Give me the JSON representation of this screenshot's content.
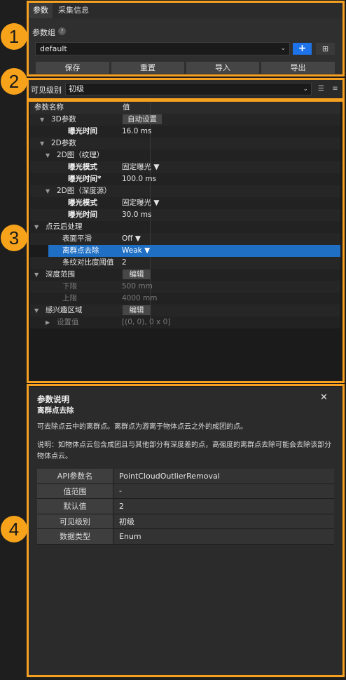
{
  "tabs": [
    "参数",
    "采集信息"
  ],
  "param_group": {
    "label": "参数组",
    "help": "?",
    "selected": "default",
    "add": "+",
    "grid": "⊞"
  },
  "actions": [
    "保存",
    "重置",
    "导入",
    "导出"
  ],
  "visibility": {
    "label": "可见级别",
    "selected": "初级"
  },
  "tree": {
    "headers": [
      "参数名称",
      "值"
    ],
    "rows": [
      {
        "name": "3D参数",
        "value": "自动设置",
        "indent": 1,
        "toggle": "▼",
        "kind": "button"
      },
      {
        "name": "曝光时间",
        "value": "16.0 ms",
        "indent": 4,
        "toggle": "",
        "kind": "bold"
      },
      {
        "name": "2D参数",
        "value": "",
        "indent": 1,
        "toggle": "▼",
        "kind": "group"
      },
      {
        "name": "2D图（纹理）",
        "value": "",
        "indent": 2,
        "toggle": "▼",
        "kind": "group"
      },
      {
        "name": "曝光模式",
        "value": "固定曝光 ▼",
        "indent": 4,
        "toggle": "",
        "kind": "bold"
      },
      {
        "name": "曝光时间*",
        "value": "100.0 ms",
        "indent": 4,
        "toggle": "",
        "kind": "bold"
      },
      {
        "name": "2D图（深度源）",
        "value": "",
        "indent": 2,
        "toggle": "▼",
        "kind": "group"
      },
      {
        "name": "曝光模式",
        "value": "固定曝光 ▼",
        "indent": 4,
        "toggle": "",
        "kind": "bold"
      },
      {
        "name": "曝光时间",
        "value": "30.0 ms",
        "indent": 4,
        "toggle": "",
        "kind": "bold"
      },
      {
        "name": "点云后处理",
        "value": "",
        "indent": 0,
        "toggle": "▼",
        "kind": "group"
      },
      {
        "name": "表面平滑",
        "value": "Off ▼",
        "indent": 3,
        "toggle": "",
        "kind": "normal"
      },
      {
        "name": "离群点去除",
        "value": "Weak ▼",
        "indent": 3,
        "toggle": "",
        "kind": "selected"
      },
      {
        "name": "条纹对比度阈值",
        "value": "2",
        "indent": 3,
        "toggle": "",
        "kind": "normal"
      },
      {
        "name": "深度范围",
        "value": "编辑",
        "indent": 0,
        "toggle": "▼",
        "kind": "button"
      },
      {
        "name": "下限",
        "value": "500 mm",
        "indent": 3,
        "toggle": "",
        "kind": "dim"
      },
      {
        "name": "上限",
        "value": "4000 mm",
        "indent": 3,
        "toggle": "",
        "kind": "dim"
      },
      {
        "name": "感兴趣区域",
        "value": "编辑",
        "indent": 0,
        "toggle": "▼",
        "kind": "button"
      },
      {
        "name": "设置值",
        "value": "[(0, 0), 0 x 0]",
        "indent": 2,
        "toggle": "▶",
        "kind": "dim"
      }
    ]
  },
  "description": {
    "title": "参数说明",
    "subtitle": "离群点去除",
    "close": "✕",
    "text1": "可去除点云中的离群点。离群点为游离于物体点云之外的成团的点。",
    "text2": "说明：如物体点云包含成团且与其他部分有深度差的点，高强度的离群点去除可能会去除该部分物体点云。",
    "table": [
      {
        "k": "API参数名",
        "v": "PointCloudOutlierRemoval"
      },
      {
        "k": "值范围",
        "v": "-"
      },
      {
        "k": "默认值",
        "v": "2"
      },
      {
        "k": "可见级别",
        "v": "初级"
      },
      {
        "k": "数据类型",
        "v": "Enum"
      }
    ]
  },
  "callouts": [
    "1",
    "2",
    "3",
    "4"
  ],
  "colors": {
    "accent": "#f5a020",
    "primary": "#1e73e8",
    "selection": "#1f6fc4"
  }
}
